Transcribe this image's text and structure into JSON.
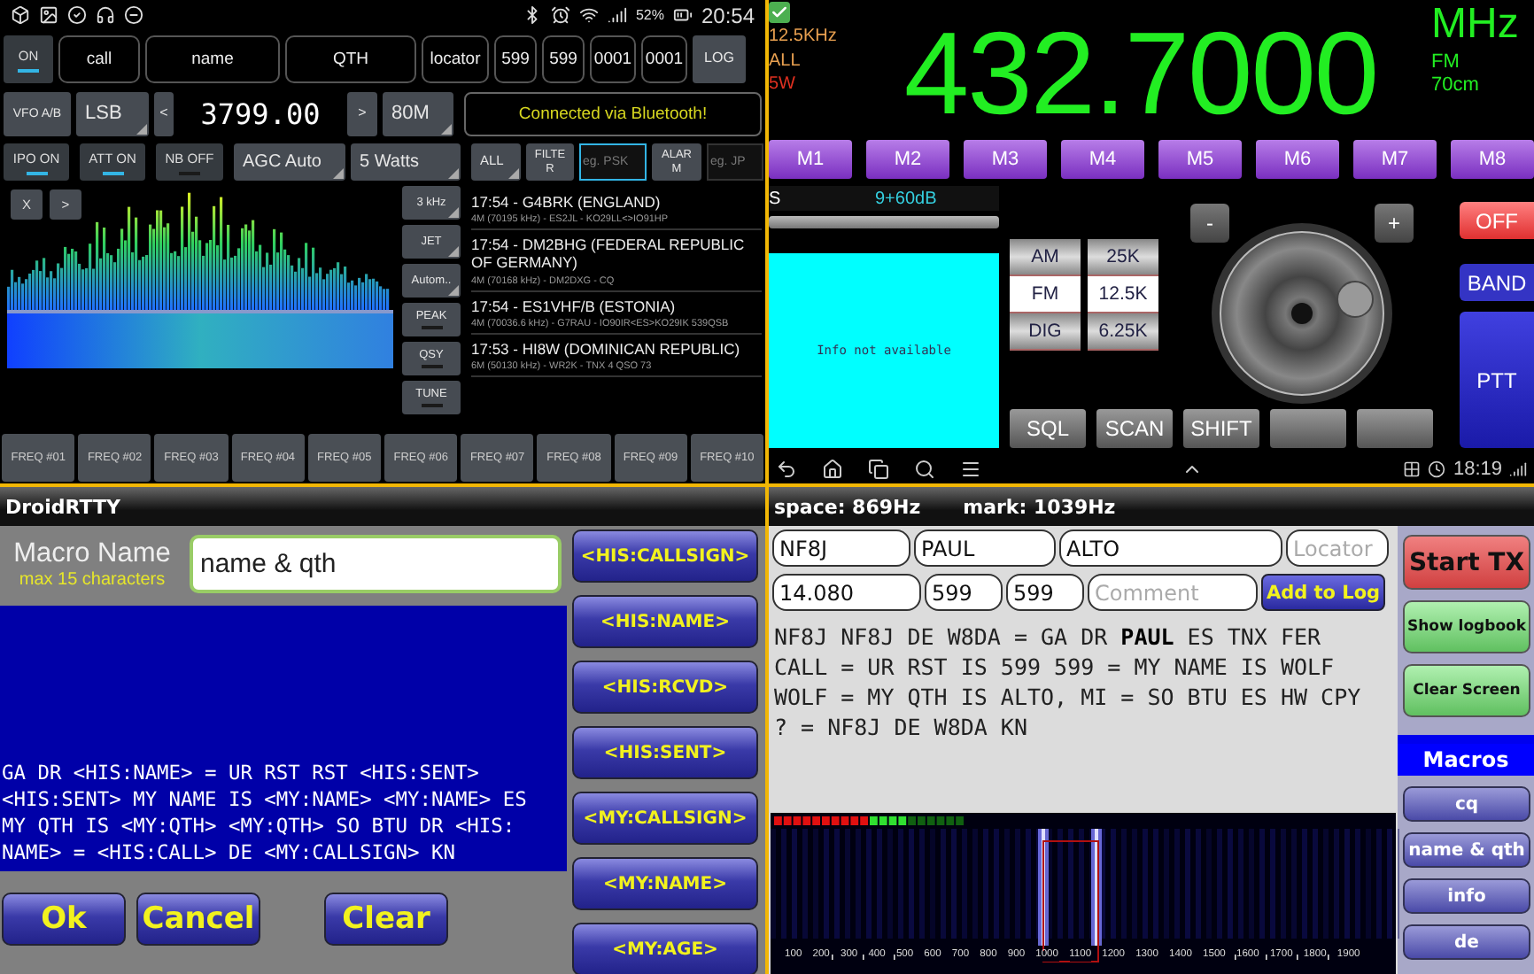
{
  "phone_logger": {
    "status_bar": {
      "battery": "52%",
      "time": "20:54"
    },
    "power_toggle": {
      "label": "ON",
      "on": true
    },
    "log_fields": [
      {
        "placeholder": "call"
      },
      {
        "placeholder": "name"
      },
      {
        "placeholder": "QTH"
      },
      {
        "placeholder": "locator"
      },
      {
        "value": "599"
      },
      {
        "value": "599"
      },
      {
        "value": "0001"
      },
      {
        "value": "0001"
      }
    ],
    "log_button": "LOG",
    "vfo_button": "VFO A/B",
    "mode": "LSB",
    "step_down": "<",
    "frequency": "3799.00",
    "step_up": ">",
    "band": "80M",
    "connection_status": "Connected via Bluetooth!",
    "toggles": [
      {
        "label": "IPO ON",
        "on": true
      },
      {
        "label": "ATT ON",
        "on": true
      },
      {
        "label": "NB OFF",
        "on": false
      }
    ],
    "agc": "AGC Auto",
    "power": "5 Watts",
    "filter_bar": {
      "all": "ALL",
      "filter": "FILTER",
      "mode_placeholder": "eg. PSK",
      "alarm": "ALARM",
      "call_placeholder": "eg. JP"
    },
    "waterfall_buttons": [
      "X",
      ">"
    ],
    "side_controls": [
      {
        "label": "3 kHz",
        "kind": "dropdown"
      },
      {
        "label": "JET",
        "kind": "dropdown"
      },
      {
        "label": "Autom..",
        "kind": "dropdown"
      },
      {
        "label": "PEAK",
        "kind": "toggle",
        "on": false
      },
      {
        "label": "QSY",
        "kind": "toggle",
        "on": false
      },
      {
        "label": "TUNE",
        "kind": "toggle",
        "on": false
      }
    ],
    "spots": [
      {
        "title": "17:54 - G4BRK (ENGLAND)",
        "detail": "4M (70195 kHz) - ES2JL - KO29LL<>IO91HP"
      },
      {
        "title": "17:54 - DM2BHG (FEDERAL REPUBLIC OF GERMANY)",
        "detail": "4M (70168 kHz) - DM2DXG - CQ"
      },
      {
        "title": "17:54 - ES1VHF/B (ESTONIA)",
        "detail": "4M (70036.6 kHz) - G7RAU - IO90IR<ES>KO29IK 539QSB"
      },
      {
        "title": "17:53 - HI8W (DOMINICAN REPUBLIC)",
        "detail": "6M (50130 kHz) - WR2K - TNX 4 QSO 73"
      }
    ],
    "memory_buttons": [
      "FREQ #01",
      "FREQ #02",
      "FREQ #03",
      "FREQ #04",
      "FREQ #05",
      "FREQ #06",
      "FREQ #07",
      "FREQ #08",
      "FREQ #09",
      "FREQ #10"
    ]
  },
  "transceiver": {
    "enabled": true,
    "step": "12.5KHz",
    "scan": "ALL",
    "tx_power": "5W",
    "frequency": "432.7000",
    "unit": "MHz",
    "mode": "FM",
    "band": "70cm",
    "memories": [
      "M1",
      "M2",
      "M3",
      "M4",
      "M5",
      "M6",
      "M7",
      "M8"
    ],
    "s_meter": {
      "label": "S",
      "reading": "9+60dB"
    },
    "info": "Info not available",
    "modes": [
      {
        "label": "AM",
        "selected": false
      },
      {
        "label": "FM",
        "selected": true
      },
      {
        "label": "DIG",
        "selected": false
      }
    ],
    "steps": [
      {
        "label": "25K",
        "selected": false
      },
      {
        "label": "12.5K",
        "selected": true
      },
      {
        "label": "6.25K",
        "selected": false
      }
    ],
    "tune_down": "-",
    "tune_up": "+",
    "off_button": "OFF",
    "band_button": "BAND",
    "ptt_button": "PTT",
    "functions": [
      "SQL",
      "SCAN",
      "SHIFT"
    ],
    "clock": "18:19"
  },
  "macro_editor": {
    "title": "DroidRTTY",
    "name_label": "Macro Name",
    "name_hint": "max 15 characters",
    "name_value": "name & qth",
    "text": "GA DR <HIS:NAME> = UR RST RST <HIS:SENT>\n<HIS:SENT> MY NAME IS <MY:NAME> <MY:NAME> ES\nMY QTH IS <MY:QTH> <MY:QTH> SO BTU DR <HIS:\nNAME> = <HIS:CALL> DE <MY:CALLSIGN> KN",
    "buttons": [
      "Ok",
      "Cancel",
      "Clear"
    ],
    "tokens": [
      "<HIS:CALLSIGN>",
      "<HIS:NAME>",
      "<HIS:RCVD>",
      "<HIS:SENT>",
      "<MY:CALLSIGN>",
      "<MY:NAME>",
      "<MY:AGE>"
    ]
  },
  "rtty_terminal": {
    "space": "space: 869Hz",
    "mark": "mark: 1039Hz",
    "fields_row_1": [
      {
        "value": "NF8J"
      },
      {
        "value": "PAUL"
      },
      {
        "value": "ALTO"
      },
      {
        "placeholder": "Locator"
      }
    ],
    "fields_row_2": [
      {
        "value": "14.080"
      },
      {
        "value": "599"
      },
      {
        "value": "599"
      },
      {
        "placeholder": "Comment"
      }
    ],
    "add_button": "Add to Log",
    "received": "NF8J NF8J DE W8DA = GA DR **PAUL** ES TNX FER\nCALL = UR RST IS 599 599 = MY NAME IS WOLF\nWOLF = MY QTH IS ALTO, MI = SO BTU ES HW CPY\n? = NF8J DE W8DA KN",
    "actions": [
      {
        "label": "Start TX",
        "kind": "transmit"
      },
      {
        "label": "Show logbook",
        "kind": "normal"
      },
      {
        "label": "Clear Screen",
        "kind": "normal"
      }
    ],
    "macros_title": "Macros",
    "macros": [
      "cq",
      "name & qth",
      "info",
      "de"
    ],
    "scale": [
      "100",
      "200",
      "300",
      "400",
      "500",
      "600",
      "700",
      "800",
      "900",
      "1000",
      "1100",
      "1200",
      "1300",
      "1400",
      "1500",
      "1600",
      "1700",
      "1800",
      "1900"
    ]
  }
}
